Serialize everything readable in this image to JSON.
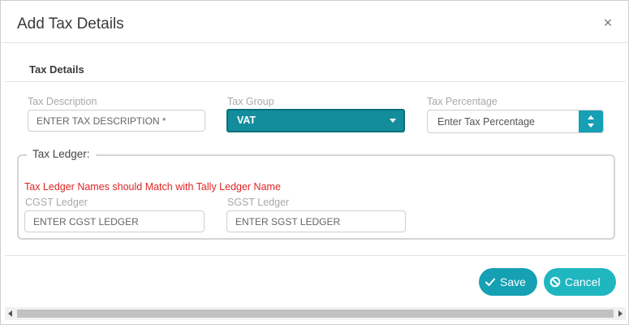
{
  "dialog": {
    "title": "Add Tax Details",
    "close_glyph": "×"
  },
  "section": {
    "title": "Tax Details"
  },
  "fields": {
    "tax_description": {
      "label": "Tax Description",
      "placeholder": "ENTER TAX DESCRIPTION *"
    },
    "tax_group": {
      "label": "Tax Group",
      "value": "VAT"
    },
    "tax_percentage": {
      "label": "Tax Percentage",
      "value": "Enter Tax Percentage"
    }
  },
  "ledger": {
    "legend": "Tax Ledger:",
    "warning": "Tax Ledger Names should Match with Tally Ledger Name",
    "cgst": {
      "label": "CGST Ledger",
      "placeholder": "ENTER CGST LEDGER"
    },
    "sgst": {
      "label": "SGST Ledger",
      "placeholder": "ENTER SGST LEDGER"
    }
  },
  "buttons": {
    "save": "Save",
    "cancel": "Cancel"
  },
  "colors": {
    "accent": "#138d9c",
    "button_save": "#16a0b4",
    "button_cancel": "#20b6c0",
    "warning": "#e02424"
  }
}
